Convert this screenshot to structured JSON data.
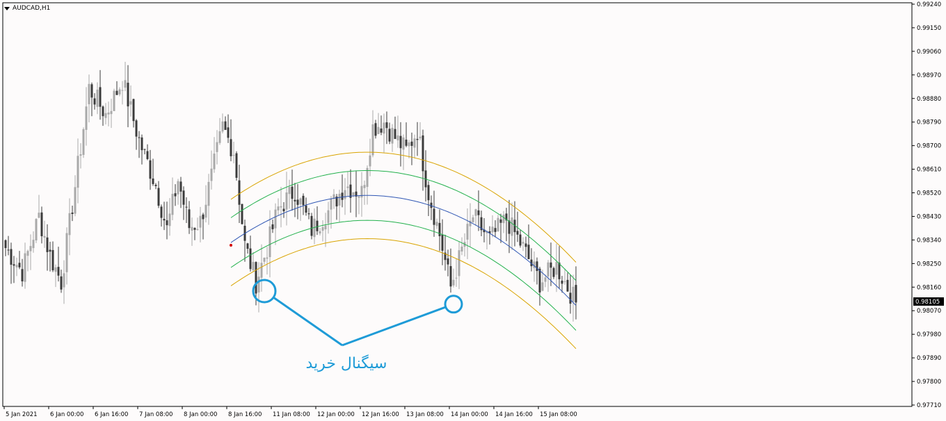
{
  "header": {
    "symbol": "AUDCAD,H1"
  },
  "annotation": {
    "text": "سیگنال خرید"
  },
  "colors": {
    "background": "#fdfbfb",
    "bull_candle": "#a9a9a9",
    "bear_candle": "#3b3b3b",
    "regression_mid": "#2f56b4",
    "inner_band": "#22b14c",
    "outer_band": "#d9a400",
    "annotation": "#1e9bd7",
    "signal_dot": "#d40000"
  },
  "chart_data": {
    "type": "candlestick",
    "title": "AUDCAD,H1",
    "ylim": [
      0.9771,
      0.9924
    ],
    "y_ticks": [
      "0.99240",
      "0.99150",
      "0.99060",
      "0.98970",
      "0.98880",
      "0.98790",
      "0.98700",
      "0.98610",
      "0.98520",
      "0.98430",
      "0.98340",
      "0.98250",
      "0.98160",
      "0.98070",
      "0.97980",
      "0.97890",
      "0.97800",
      "0.97710"
    ],
    "x_ticks": [
      "5 Jan 2021",
      "6 Jan 00:00",
      "6 Jan 16:00",
      "7 Jan 08:00",
      "8 Jan 00:00",
      "8 Jan 16:00",
      "11 Jan 08:00",
      "12 Jan 00:00",
      "12 Jan 16:00",
      "13 Jan 08:00",
      "14 Jan 00:00",
      "14 Jan 16:00",
      "15 Jan 08:00"
    ],
    "current_price": "0.98105",
    "bars": 206,
    "series_close_anchors": [
      {
        "bar": 0,
        "close": 0.9831
      },
      {
        "bar": 6,
        "close": 0.9822
      },
      {
        "bar": 12,
        "close": 0.9843
      },
      {
        "bar": 16,
        "close": 0.9828
      },
      {
        "bar": 20,
        "close": 0.9818
      },
      {
        "bar": 26,
        "close": 0.9862
      },
      {
        "bar": 30,
        "close": 0.9892
      },
      {
        "bar": 36,
        "close": 0.9882
      },
      {
        "bar": 42,
        "close": 0.9895
      },
      {
        "bar": 48,
        "close": 0.9872
      },
      {
        "bar": 54,
        "close": 0.9855
      },
      {
        "bar": 58,
        "close": 0.9838
      },
      {
        "bar": 62,
        "close": 0.9857
      },
      {
        "bar": 66,
        "close": 0.9839
      },
      {
        "bar": 70,
        "close": 0.9841
      },
      {
        "bar": 74,
        "close": 0.9858
      },
      {
        "bar": 78,
        "close": 0.9877
      },
      {
        "bar": 82,
        "close": 0.9868
      },
      {
        "bar": 86,
        "close": 0.9832
      },
      {
        "bar": 90,
        "close": 0.9818
      },
      {
        "bar": 94,
        "close": 0.9831
      },
      {
        "bar": 98,
        "close": 0.9846
      },
      {
        "bar": 104,
        "close": 0.9853
      },
      {
        "bar": 110,
        "close": 0.9838
      },
      {
        "bar": 116,
        "close": 0.9845
      },
      {
        "bar": 122,
        "close": 0.9855
      },
      {
        "bar": 128,
        "close": 0.9852
      },
      {
        "bar": 132,
        "close": 0.9877
      },
      {
        "bar": 136,
        "close": 0.9879
      },
      {
        "bar": 140,
        "close": 0.9873
      },
      {
        "bar": 144,
        "close": 0.9868
      },
      {
        "bar": 148,
        "close": 0.9876
      },
      {
        "bar": 152,
        "close": 0.9852
      },
      {
        "bar": 156,
        "close": 0.9836
      },
      {
        "bar": 160,
        "close": 0.9816
      },
      {
        "bar": 164,
        "close": 0.983
      },
      {
        "bar": 168,
        "close": 0.9843
      },
      {
        "bar": 174,
        "close": 0.9834
      },
      {
        "bar": 180,
        "close": 0.9842
      },
      {
        "bar": 186,
        "close": 0.9831
      },
      {
        "bar": 192,
        "close": 0.9818
      },
      {
        "bar": 198,
        "close": 0.9824
      },
      {
        "bar": 205,
        "close": 0.981
      }
    ],
    "regression_channel": {
      "start_bar": 81,
      "end_bar": 205,
      "mid": [
        {
          "bar": 81,
          "value": 0.9833
        },
        {
          "bar": 130,
          "value": 0.9851
        },
        {
          "bar": 205,
          "value": 0.9809
        }
      ],
      "inner_offset": 0.00095,
      "outer_offset": 0.00165
    },
    "signal_dot": {
      "bar": 81,
      "value": 0.9832
    },
    "signals": [
      {
        "bar": 93,
        "value": 0.98145
      },
      {
        "bar": 161,
        "value": 0.98095
      }
    ]
  }
}
